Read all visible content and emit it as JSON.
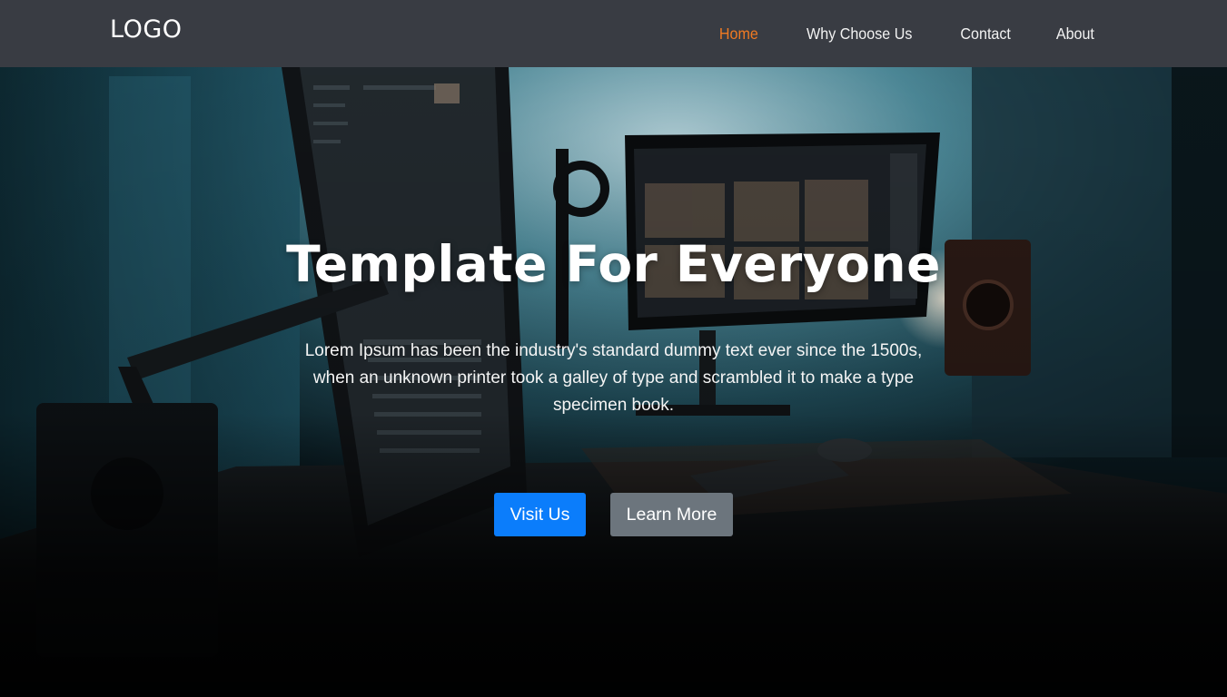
{
  "navbar": {
    "logo": "LOGO",
    "links": [
      {
        "label": "Home",
        "active": true
      },
      {
        "label": "Why Choose Us",
        "active": false
      },
      {
        "label": "Contact",
        "active": false
      },
      {
        "label": "About",
        "active": false
      }
    ]
  },
  "hero": {
    "title": "Template For Everyone",
    "text": "Lorem Ipsum has been the industry's standard dummy text ever since the 1500s, when an unknown printer took a galley of type and scrambled it to make a type specimen book.",
    "primary_button": "Visit Us",
    "secondary_button": "Learn More"
  },
  "colors": {
    "navbar_bg": "#393c43",
    "active_link": "#f07a22",
    "primary_button": "#0b7dfb",
    "secondary_button": "#6c757d"
  }
}
